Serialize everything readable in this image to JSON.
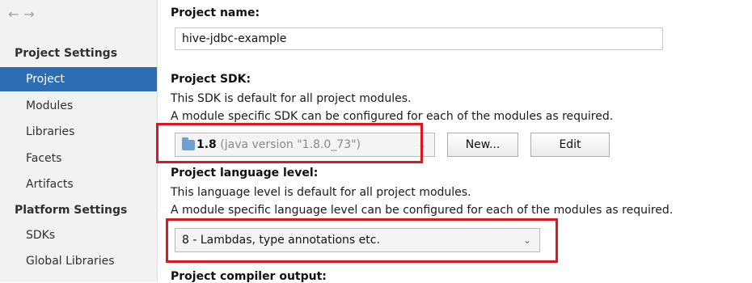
{
  "sidebar": {
    "back_arrow": "←",
    "forward_arrow": "→",
    "project_settings_header": "Project Settings",
    "project_items": [
      "Project",
      "Modules",
      "Libraries",
      "Facets",
      "Artifacts"
    ],
    "platform_settings_header": "Platform Settings",
    "platform_items": [
      "SDKs",
      "Global Libraries"
    ],
    "selected": "Project"
  },
  "main": {
    "project_name_label": "Project name:",
    "project_name_value": "hive-jdbc-example",
    "sdk_label": "Project SDK:",
    "sdk_desc_1": "This SDK is default for all project modules.",
    "sdk_desc_2": "A module specific SDK can be configured for each of the modules as required.",
    "sdk_version": "1.8",
    "sdk_version_detail": "(java version \"1.8.0_73\")",
    "new_button": "New...",
    "edit_button": "Edit",
    "lang_label": "Project language level:",
    "lang_desc_1": "This language level is default for all project modules.",
    "lang_desc_2": "A module specific language level can be configured for each of the modules as required.",
    "lang_value": "8 - Lambdas, type annotations etc.",
    "compiler_label": "Project compiler output:"
  },
  "colors": {
    "selection": "#2c6db5",
    "highlight": "#e0151f"
  }
}
